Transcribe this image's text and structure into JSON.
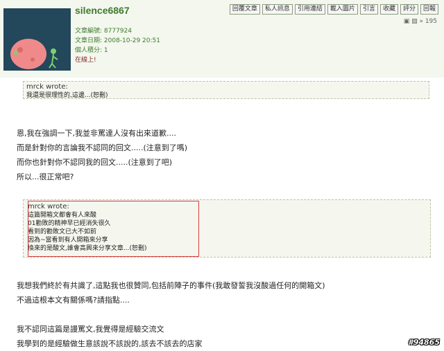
{
  "post": {
    "username": "silence6867",
    "article_no": "文章編號: 8777924",
    "article_date": "文章日期: 2008-10-29 20:51",
    "points": "個人積分: 1",
    "online": "在線上!",
    "buttons": [
      "回覆文章",
      "私人訊息",
      "引用連結",
      "載入圖片",
      "引言",
      "收藏",
      "評分",
      "回報"
    ],
    "right_meta": "▣ ▧ » 195"
  },
  "quote1": {
    "wrote": "mrck wrote:",
    "text": "我還是很理性的,這邊...(恕刪)"
  },
  "paragraph1": [
    "恩,我在強調一下,我並非罵達人沒有出來道歉....",
    "而是針對你的言論我不認同的回文.....(注意到了嗎)",
    "而你也針對你不認同我的回文.....(注意到了吧)",
    "所以...很正常吧?"
  ],
  "quote2": {
    "wrote": "mrck wrote:",
    "lines": [
      "這篇開箱文都會有人來酸",
      "01勸敗的精神早已經消失很久",
      "看到的勸敗文已大不如前",
      "因為~當看到有人開箱來分享",
      "換來的是酸文,誰會高興來分享文章...(恕刪)"
    ]
  },
  "paragraph2": [
    "我想我們終於有共識了,這點我也很贊同,包括前陣子的事件(我敢發誓我沒酸過任何的開箱文)",
    "不過這根本文有關係嗎?請指點...."
  ],
  "paragraph3": [
    "我不認同這篇是謾罵文,我覺得是經驗交流文",
    "我學到的是經驗做生意該說不該說的,該去不該去的店家"
  ],
  "watermark": "#94865"
}
